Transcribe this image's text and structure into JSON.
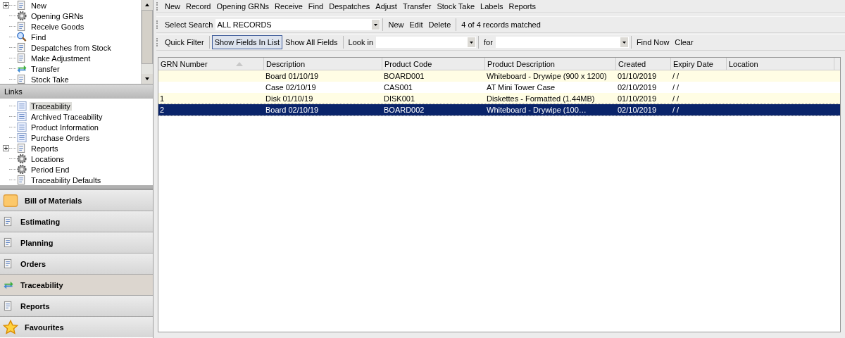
{
  "sidebar": {
    "tasks": [
      {
        "label": "New",
        "kind": "group",
        "expanded": false
      },
      {
        "label": "Opening GRNs",
        "kind": "leaf"
      },
      {
        "label": "Receive Goods",
        "kind": "leaf"
      },
      {
        "label": "Find",
        "kind": "leaf"
      },
      {
        "label": "Despatches from Stock",
        "kind": "leaf"
      },
      {
        "label": "Make Adjustment",
        "kind": "leaf"
      },
      {
        "label": "Transfer",
        "kind": "leaf"
      },
      {
        "label": "Stock Take",
        "kind": "leaf"
      }
    ],
    "links_title": "Links",
    "links": [
      {
        "label": "Traceability",
        "selected": true,
        "kind": "leaf"
      },
      {
        "label": "Archived Traceability",
        "selected": false,
        "kind": "leaf"
      },
      {
        "label": "Product Information",
        "selected": false,
        "kind": "leaf"
      },
      {
        "label": "Purchase Orders",
        "selected": false,
        "kind": "leaf"
      },
      {
        "label": "Reports",
        "selected": false,
        "kind": "group",
        "expanded": false
      },
      {
        "label": "Locations",
        "selected": false,
        "kind": "leaf"
      },
      {
        "label": "Period End",
        "selected": false,
        "kind": "leaf"
      },
      {
        "label": "Traceability Defaults",
        "selected": false,
        "kind": "leaf"
      }
    ],
    "modules": [
      {
        "label": "Bill of Materials",
        "selected": false
      },
      {
        "label": "Estimating",
        "selected": false
      },
      {
        "label": "Planning",
        "selected": false
      },
      {
        "label": "Orders",
        "selected": false
      },
      {
        "label": "Traceability",
        "selected": true
      },
      {
        "label": "Reports",
        "selected": false
      },
      {
        "label": "Favourites",
        "selected": false
      }
    ]
  },
  "toolbar": [
    "New",
    "Record",
    "Opening GRNs",
    "Receive",
    "Find",
    "Despatches",
    "Adjust",
    "Transfer",
    "Stock Take",
    "Labels",
    "Reports"
  ],
  "search_bar": {
    "label": "Select Search",
    "value": "ALL RECORDS",
    "buttons": [
      "New",
      "Edit",
      "Delete"
    ],
    "status": "4 of 4 records matched"
  },
  "filter_bar": {
    "quick_filter": "Quick Filter",
    "toggles": [
      {
        "label": "Show Fields In List",
        "selected": true
      },
      {
        "label": "Show All Fields",
        "selected": false
      }
    ],
    "look_in_label": "Look in",
    "for_label": "for",
    "buttons": [
      "Find Now",
      "Clear"
    ]
  },
  "table": {
    "columns": [
      "GRN Number",
      "Description",
      "Product Code",
      "Product Description",
      "Created",
      "Expiry Date",
      "Location"
    ],
    "rows": [
      {
        "selected": false,
        "cells": [
          "",
          "Board 01/10/19",
          "BOARD001",
          "Whiteboard - Drywipe (900 x 1200)",
          "01/10/2019",
          "/ /",
          ""
        ]
      },
      {
        "selected": false,
        "cells": [
          "",
          "Case 02/10/19",
          "CAS001",
          "AT Mini Tower Case",
          "02/10/2019",
          "/ /",
          ""
        ]
      },
      {
        "selected": false,
        "cells": [
          "1",
          "Disk 01/10/19",
          "DISK001",
          "Diskettes - Formatted (1.44MB)",
          "01/10/2019",
          "/ /",
          ""
        ]
      },
      {
        "selected": true,
        "cells": [
          "2",
          "Board 02/10/19",
          "BOARD002",
          "Whiteboard - Drywipe (100…",
          "02/10/2019",
          "/ /",
          ""
        ]
      }
    ]
  }
}
